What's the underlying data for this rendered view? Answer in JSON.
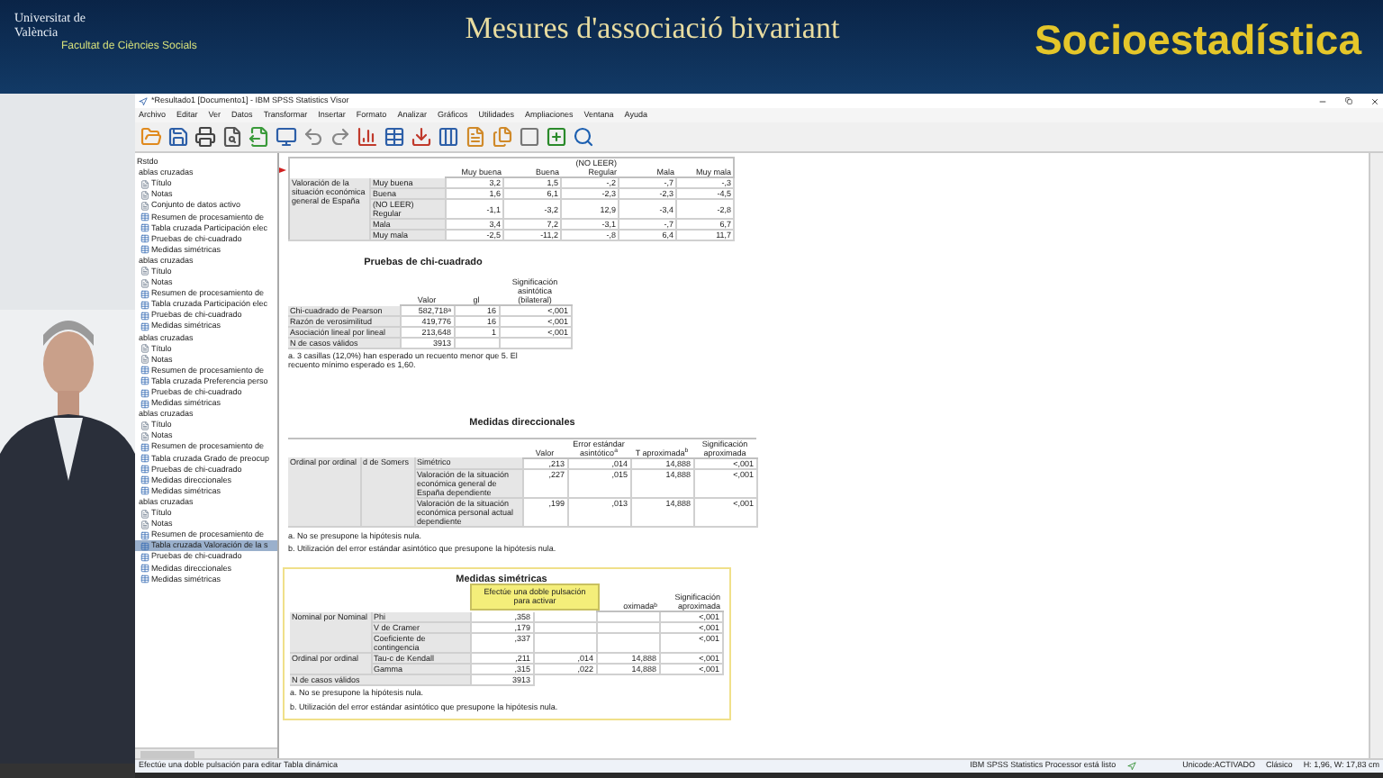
{
  "header": {
    "logo": [
      "Universitat de València",
      "Facultat de Ciències Socials"
    ],
    "title": "Mesures d'associació bivariant",
    "course": "Socioestadística"
  },
  "window": {
    "title": "*Resultado1 [Documento1] - IBM SPSS Statistics Visor",
    "menu": [
      "Archivo",
      "Editar",
      "Ver",
      "Datos",
      "Transformar",
      "Insertar",
      "Formato",
      "Analizar",
      "Gráficos",
      "Utilidades",
      "Ampliaciones",
      "Ventana",
      "Ayuda"
    ]
  },
  "outline": {
    "root": "Rstdo",
    "groups": [
      {
        "label": "ablas cruzadas",
        "children": [
          {
            "label": "Título",
            "kind": "text",
            "selected": false
          },
          {
            "label": "Notas",
            "kind": "text",
            "selected": false
          },
          {
            "label": "Conjunto de datos activo",
            "kind": "text",
            "selected": false
          },
          {
            "label": "Resumen de procesamiento de",
            "kind": "table",
            "selected": false
          },
          {
            "label": "Tabla cruzada Participación elec",
            "kind": "table",
            "selected": false
          },
          {
            "label": "Pruebas de chi-cuadrado",
            "kind": "table",
            "selected": false
          },
          {
            "label": "Medidas simétricas",
            "kind": "table",
            "selected": false
          }
        ]
      },
      {
        "label": "ablas cruzadas",
        "children": [
          {
            "label": "Título",
            "kind": "text",
            "selected": false
          },
          {
            "label": "Notas",
            "kind": "text",
            "selected": false
          },
          {
            "label": "Resumen de procesamiento de",
            "kind": "table",
            "selected": false
          },
          {
            "label": "Tabla cruzada Participación elec",
            "kind": "table",
            "selected": false
          },
          {
            "label": "Pruebas de chi-cuadrado",
            "kind": "table",
            "selected": false
          },
          {
            "label": "Medidas simétricas",
            "kind": "table",
            "selected": false
          }
        ]
      },
      {
        "label": "ablas cruzadas",
        "children": [
          {
            "label": "Título",
            "kind": "text",
            "selected": false
          },
          {
            "label": "Notas",
            "kind": "text",
            "selected": false
          },
          {
            "label": "Resumen de procesamiento de",
            "kind": "table",
            "selected": false
          },
          {
            "label": "Tabla cruzada Preferencia perso",
            "kind": "table",
            "selected": false
          },
          {
            "label": "Pruebas de chi-cuadrado",
            "kind": "table",
            "selected": false
          },
          {
            "label": "Medidas simétricas",
            "kind": "table",
            "selected": false
          }
        ]
      },
      {
        "label": "ablas cruzadas",
        "children": [
          {
            "label": "Título",
            "kind": "text",
            "selected": false
          },
          {
            "label": "Notas",
            "kind": "text",
            "selected": false
          },
          {
            "label": "Resumen de procesamiento de",
            "kind": "table",
            "selected": false
          },
          {
            "label": "Tabla cruzada Grado de preocup",
            "kind": "table",
            "selected": false
          },
          {
            "label": "Pruebas de chi-cuadrado",
            "kind": "table",
            "selected": false
          },
          {
            "label": "Medidas direccionales",
            "kind": "table",
            "selected": false
          },
          {
            "label": "Medidas simétricas",
            "kind": "table",
            "selected": false
          }
        ]
      },
      {
        "label": "ablas cruzadas",
        "children": [
          {
            "label": "Título",
            "kind": "text",
            "selected": false
          },
          {
            "label": "Notas",
            "kind": "text",
            "selected": false
          },
          {
            "label": "Resumen de procesamiento de",
            "kind": "table",
            "selected": false
          },
          {
            "label": "Tabla cruzada Valoración de la s",
            "kind": "table",
            "selected": true
          },
          {
            "label": "Pruebas de chi-cuadrado",
            "kind": "table",
            "selected": false
          },
          {
            "label": "Medidas direccionales",
            "kind": "table",
            "selected": false
          },
          {
            "label": "Medidas simétricas",
            "kind": "table",
            "selected": false
          }
        ]
      }
    ]
  },
  "crosstab": {
    "columns": [
      "Muy buena",
      "Buena",
      "(NO LEER) Regular",
      "Mala",
      "Muy mala"
    ],
    "row_group": "Valoración de la situación económica general de España",
    "rows": [
      {
        "label": "Muy buena",
        "values": [
          "3,2",
          "1,5",
          "-,2",
          "-,7",
          "-,3"
        ]
      },
      {
        "label": "Buena",
        "values": [
          "1,6",
          "6,1",
          "-2,3",
          "-2,3",
          "-4,5"
        ]
      },
      {
        "label": "(NO LEER) Regular",
        "values": [
          "-1,1",
          "-3,2",
          "12,9",
          "-3,4",
          "-2,8"
        ]
      },
      {
        "label": "Mala",
        "values": [
          "3,4",
          "7,2",
          "-3,1",
          "-,7",
          "6,7"
        ]
      },
      {
        "label": "Muy mala",
        "values": [
          "-2,5",
          "-11,2",
          "-,8",
          "6,4",
          "11,7"
        ]
      }
    ]
  },
  "chi_square": {
    "title": "Pruebas de chi-cuadrado",
    "columns": [
      "Valor",
      "gl",
      "Significación asintótica (bilateral)"
    ],
    "rows": [
      {
        "label": "Chi-cuadrado de Pearson",
        "values": [
          "582,718$^{a}$",
          "16",
          "<,001"
        ]
      },
      {
        "label": "Razón de verosimilitud",
        "values": [
          "419,776",
          "16",
          "<,001"
        ]
      },
      {
        "label": "Asociación lineal por lineal",
        "values": [
          "213,648",
          "1",
          "<,001"
        ]
      },
      {
        "label": "N de casos válidos",
        "values": [
          "3913"
        ]
      }
    ],
    "footnotes": [
      "a. 3 casillas (12,0%) han esperado un recuento menor que 5. El recuento mínimo esperado es 1,60."
    ]
  },
  "directional": {
    "title": "Medidas direccionales",
    "columns": [
      "Valor",
      "Error estándar asintótico$^{a}$",
      "T aproximada$^{b}$",
      "Significación aproximada"
    ],
    "category": "Ordinal por ordinal",
    "measure": "d de Somers",
    "rows": [
      {
        "label": "Simétrico",
        "values": [
          ",213",
          ",014",
          "14,888",
          "<,001"
        ]
      },
      {
        "label": "Valoración de la situación económica general de España dependiente",
        "values": [
          ",227",
          ",015",
          "14,888",
          "<,001"
        ]
      },
      {
        "label": "Valoración de la situación económica personal actual dependiente",
        "values": [
          ",199",
          ",013",
          "14,888",
          "<,001"
        ]
      }
    ],
    "footnotes": [
      "a. No se presupone la hipótesis nula.",
      "b. Utilización del error estándar asintótico que presupone la hipótesis nula."
    ]
  },
  "symmetric": {
    "title": "Medidas simétricas",
    "tooltip": "Efectúe una doble pulsación para activar",
    "columns": [
      "oximada$^{b}$",
      "Significación aproximada"
    ],
    "groups": [
      {
        "category": "Nominal por Nominal",
        "rows": [
          {
            "label": "Phi",
            "values": [
              ",358",
              "<,001"
            ]
          },
          {
            "label": "V de Cramer",
            "values": [
              ",179",
              "<,001"
            ]
          },
          {
            "label": "Coeficiente de contingencia",
            "values": [
              ",337",
              "<,001"
            ]
          }
        ]
      },
      {
        "category": "Ordinal por ordinal",
        "rows": [
          {
            "label": "Tau-c de Kendall",
            "values": [
              ",211",
              ",014",
              "14,888",
              "<,001"
            ]
          },
          {
            "label": "Gamma",
            "values": [
              ",315",
              ",022",
              "14,888",
              "<,001"
            ]
          }
        ]
      }
    ],
    "total": {
      "label": "N de casos válidos",
      "value": "3913"
    },
    "footnotes": [
      "a. No se presupone la hipótesis nula.",
      "b. Utilización del error estándar asintótico que presupone la hipótesis nula."
    ]
  },
  "status_bar": {
    "message": "Efectúe una doble pulsación para editar Tabla dinámica",
    "processor": "IBM SPSS Statistics Processor está listo",
    "unicode": "Unicode:ACTIVADO",
    "mode": "Clásico",
    "size": "H: 1,96, W: 17,83 cm"
  }
}
